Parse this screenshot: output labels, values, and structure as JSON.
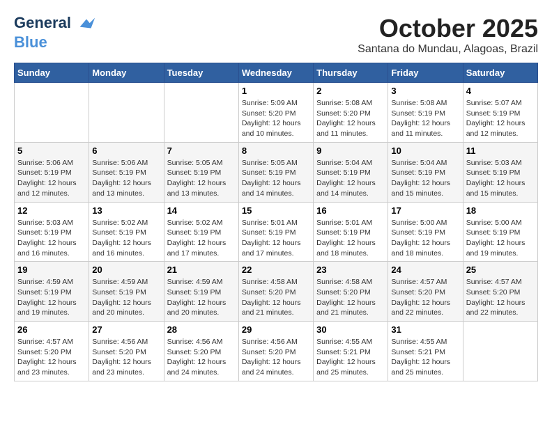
{
  "header": {
    "logo_line1": "General",
    "logo_line2": "Blue",
    "month": "October 2025",
    "location": "Santana do Mundau, Alagoas, Brazil"
  },
  "weekdays": [
    "Sunday",
    "Monday",
    "Tuesday",
    "Wednesday",
    "Thursday",
    "Friday",
    "Saturday"
  ],
  "weeks": [
    [
      {
        "day": "",
        "info": ""
      },
      {
        "day": "",
        "info": ""
      },
      {
        "day": "",
        "info": ""
      },
      {
        "day": "1",
        "info": "Sunrise: 5:09 AM\nSunset: 5:20 PM\nDaylight: 12 hours\nand 10 minutes."
      },
      {
        "day": "2",
        "info": "Sunrise: 5:08 AM\nSunset: 5:20 PM\nDaylight: 12 hours\nand 11 minutes."
      },
      {
        "day": "3",
        "info": "Sunrise: 5:08 AM\nSunset: 5:19 PM\nDaylight: 12 hours\nand 11 minutes."
      },
      {
        "day": "4",
        "info": "Sunrise: 5:07 AM\nSunset: 5:19 PM\nDaylight: 12 hours\nand 12 minutes."
      }
    ],
    [
      {
        "day": "5",
        "info": "Sunrise: 5:06 AM\nSunset: 5:19 PM\nDaylight: 12 hours\nand 12 minutes."
      },
      {
        "day": "6",
        "info": "Sunrise: 5:06 AM\nSunset: 5:19 PM\nDaylight: 12 hours\nand 13 minutes."
      },
      {
        "day": "7",
        "info": "Sunrise: 5:05 AM\nSunset: 5:19 PM\nDaylight: 12 hours\nand 13 minutes."
      },
      {
        "day": "8",
        "info": "Sunrise: 5:05 AM\nSunset: 5:19 PM\nDaylight: 12 hours\nand 14 minutes."
      },
      {
        "day": "9",
        "info": "Sunrise: 5:04 AM\nSunset: 5:19 PM\nDaylight: 12 hours\nand 14 minutes."
      },
      {
        "day": "10",
        "info": "Sunrise: 5:04 AM\nSunset: 5:19 PM\nDaylight: 12 hours\nand 15 minutes."
      },
      {
        "day": "11",
        "info": "Sunrise: 5:03 AM\nSunset: 5:19 PM\nDaylight: 12 hours\nand 15 minutes."
      }
    ],
    [
      {
        "day": "12",
        "info": "Sunrise: 5:03 AM\nSunset: 5:19 PM\nDaylight: 12 hours\nand 16 minutes."
      },
      {
        "day": "13",
        "info": "Sunrise: 5:02 AM\nSunset: 5:19 PM\nDaylight: 12 hours\nand 16 minutes."
      },
      {
        "day": "14",
        "info": "Sunrise: 5:02 AM\nSunset: 5:19 PM\nDaylight: 12 hours\nand 17 minutes."
      },
      {
        "day": "15",
        "info": "Sunrise: 5:01 AM\nSunset: 5:19 PM\nDaylight: 12 hours\nand 17 minutes."
      },
      {
        "day": "16",
        "info": "Sunrise: 5:01 AM\nSunset: 5:19 PM\nDaylight: 12 hours\nand 18 minutes."
      },
      {
        "day": "17",
        "info": "Sunrise: 5:00 AM\nSunset: 5:19 PM\nDaylight: 12 hours\nand 18 minutes."
      },
      {
        "day": "18",
        "info": "Sunrise: 5:00 AM\nSunset: 5:19 PM\nDaylight: 12 hours\nand 19 minutes."
      }
    ],
    [
      {
        "day": "19",
        "info": "Sunrise: 4:59 AM\nSunset: 5:19 PM\nDaylight: 12 hours\nand 19 minutes."
      },
      {
        "day": "20",
        "info": "Sunrise: 4:59 AM\nSunset: 5:19 PM\nDaylight: 12 hours\nand 20 minutes."
      },
      {
        "day": "21",
        "info": "Sunrise: 4:59 AM\nSunset: 5:19 PM\nDaylight: 12 hours\nand 20 minutes."
      },
      {
        "day": "22",
        "info": "Sunrise: 4:58 AM\nSunset: 5:20 PM\nDaylight: 12 hours\nand 21 minutes."
      },
      {
        "day": "23",
        "info": "Sunrise: 4:58 AM\nSunset: 5:20 PM\nDaylight: 12 hours\nand 21 minutes."
      },
      {
        "day": "24",
        "info": "Sunrise: 4:57 AM\nSunset: 5:20 PM\nDaylight: 12 hours\nand 22 minutes."
      },
      {
        "day": "25",
        "info": "Sunrise: 4:57 AM\nSunset: 5:20 PM\nDaylight: 12 hours\nand 22 minutes."
      }
    ],
    [
      {
        "day": "26",
        "info": "Sunrise: 4:57 AM\nSunset: 5:20 PM\nDaylight: 12 hours\nand 23 minutes."
      },
      {
        "day": "27",
        "info": "Sunrise: 4:56 AM\nSunset: 5:20 PM\nDaylight: 12 hours\nand 23 minutes."
      },
      {
        "day": "28",
        "info": "Sunrise: 4:56 AM\nSunset: 5:20 PM\nDaylight: 12 hours\nand 24 minutes."
      },
      {
        "day": "29",
        "info": "Sunrise: 4:56 AM\nSunset: 5:20 PM\nDaylight: 12 hours\nand 24 minutes."
      },
      {
        "day": "30",
        "info": "Sunrise: 4:55 AM\nSunset: 5:21 PM\nDaylight: 12 hours\nand 25 minutes."
      },
      {
        "day": "31",
        "info": "Sunrise: 4:55 AM\nSunset: 5:21 PM\nDaylight: 12 hours\nand 25 minutes."
      },
      {
        "day": "",
        "info": ""
      }
    ]
  ]
}
